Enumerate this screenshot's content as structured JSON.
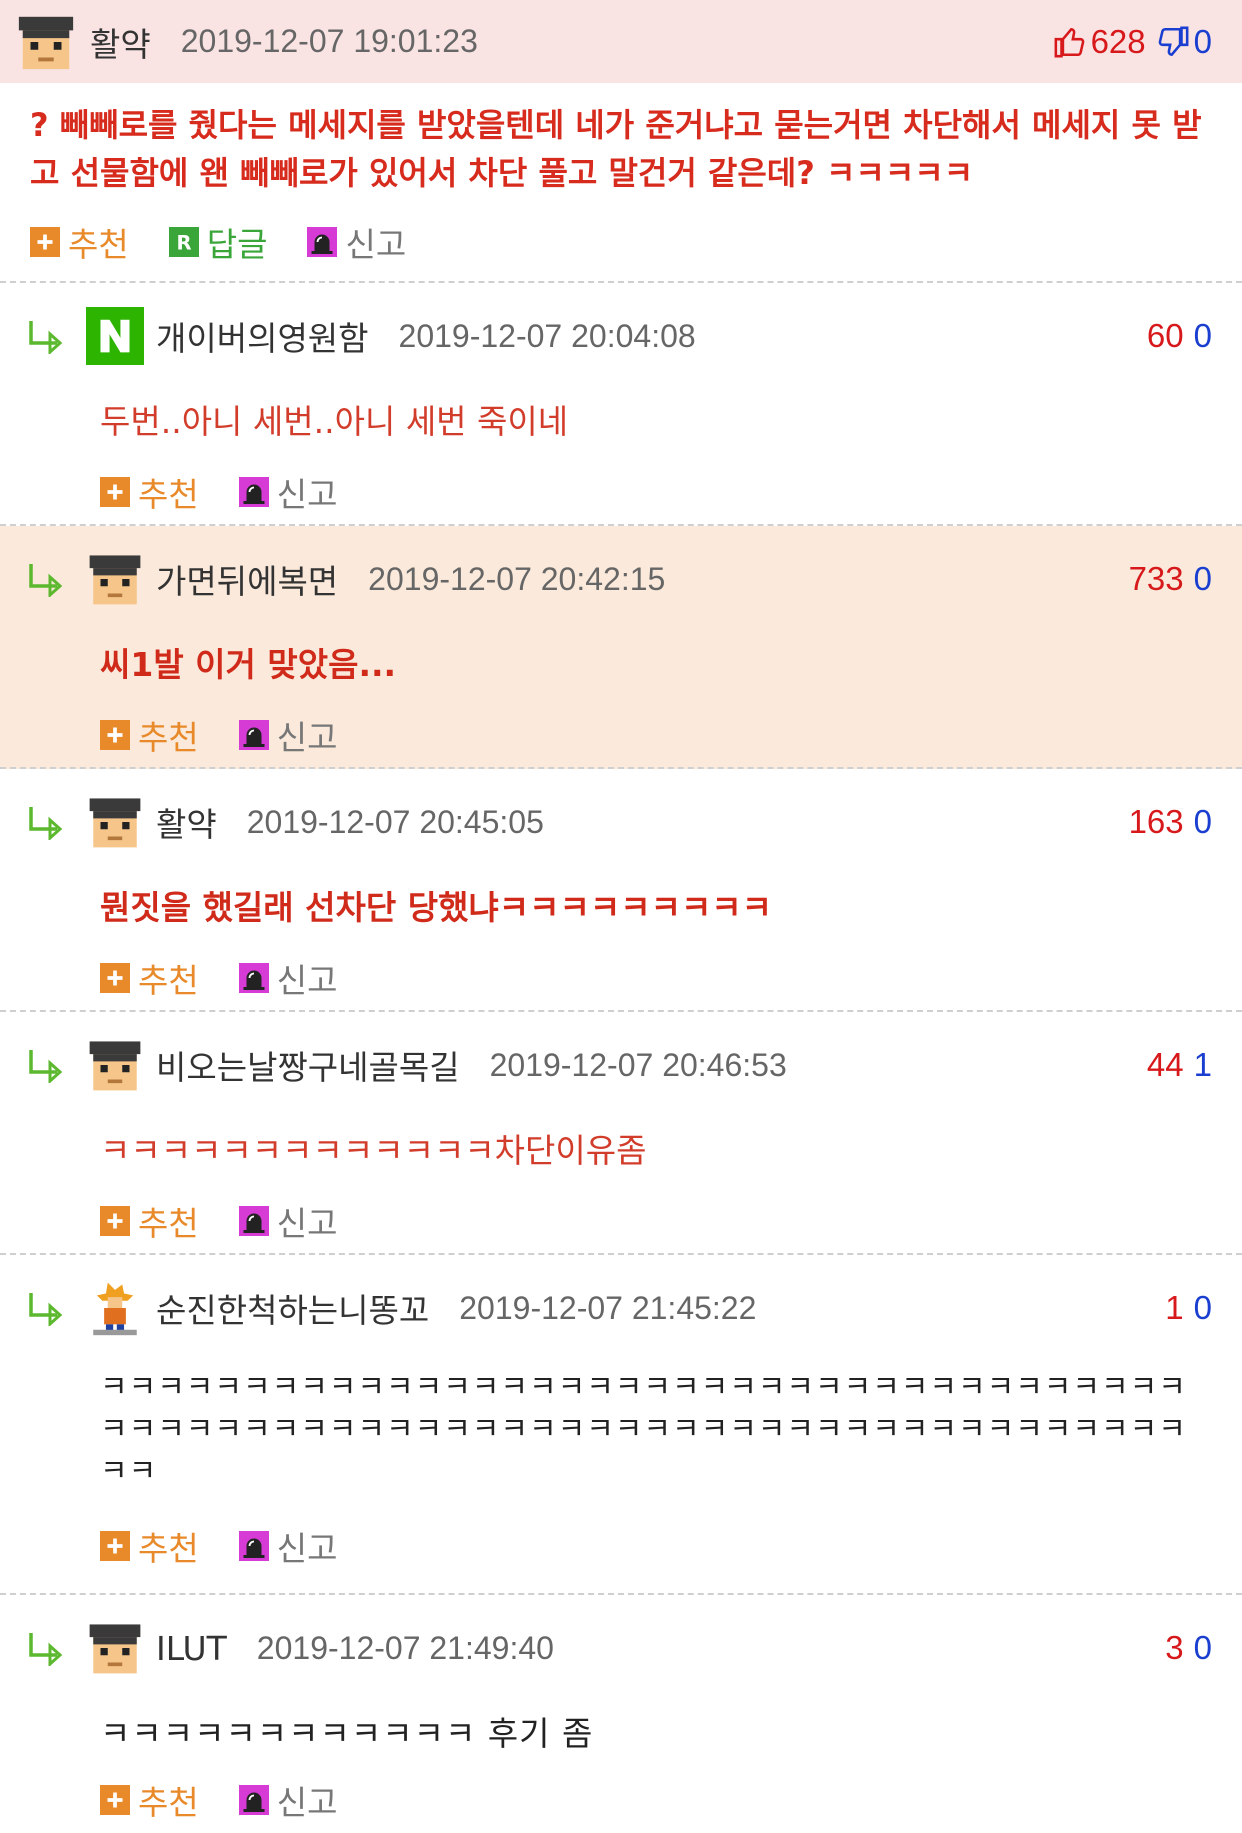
{
  "comments": [
    {
      "id": "c0",
      "type": "top",
      "nick": "활약",
      "date": "2019-12-07 19:01:23",
      "up": "628",
      "down": "0",
      "text": "? 빼빼로를 줬다는 메세지를 받았을텐데 네가 준거냐고 묻는거면 차단해서 메세지 못 받고 선물함에 왠 빼빼로가 있어서 차단 풀고 말건거 같은데? ㅋㅋㅋㅋㅋ"
    },
    {
      "id": "c1",
      "nick": "개이버의영원함",
      "date": "2019-12-07 20:04:08",
      "up": "60",
      "down": "0",
      "text": "두번..아니 세번..아니 세번 죽이네"
    },
    {
      "id": "c2",
      "nick": "가면뒤에복면",
      "date": "2019-12-07 20:42:15",
      "up": "733",
      "down": "0",
      "text": "씨1발 이거 맞았음..."
    },
    {
      "id": "c3",
      "nick": "활약",
      "date": "2019-12-07 20:45:05",
      "up": "163",
      "down": "0",
      "text": "뭔짓을 했길래 선차단 당했냐ㅋㅋㅋㅋㅋㅋㅋㅋㅋ"
    },
    {
      "id": "c4",
      "nick": "비오는날짱구네골목길",
      "date": "2019-12-07 20:46:53",
      "up": "44",
      "down": "1",
      "text": "ㅋㅋㅋㅋㅋㅋㅋㅋㅋㅋㅋㅋㅋ차단이유좀"
    },
    {
      "id": "c5",
      "nick": "순진한척하는니똥꼬",
      "date": "2019-12-07 21:45:22",
      "up": "1",
      "down": "0",
      "text": "ㅋㅋㅋㅋㅋㅋㅋㅋㅋㅋㅋㅋㅋㅋㅋㅋㅋㅋㅋㅋㅋㅋㅋㅋㅋㅋㅋㅋㅋㅋㅋㅋㅋㅋㅋㅋㅋㅋㅋㅋㅋㅋㅋㅋㅋㅋㅋㅋㅋㅋㅋㅋㅋㅋㅋㅋㅋㅋㅋㅋㅋㅋㅋㅋㅋㅋㅋㅋㅋㅋㅋㅋㅋㅋㅋㅋㅋㅋ"
    },
    {
      "id": "c6",
      "nick": "ILUT",
      "date": "2019-12-07 21:49:40",
      "up": "3",
      "down": "0",
      "text": "ㅋㅋㅋㅋㅋㅋㅋㅋㅋㅋㅋㅋ 후기 좀"
    }
  ],
  "actions": {
    "recommend": "추천",
    "reply": "답글",
    "report": "신고"
  },
  "colors": {
    "up": "#d7191c",
    "down": "#1a3fd0",
    "top_header_bg": "#f9e3e3",
    "highlight_bg": "#fbeadb"
  }
}
